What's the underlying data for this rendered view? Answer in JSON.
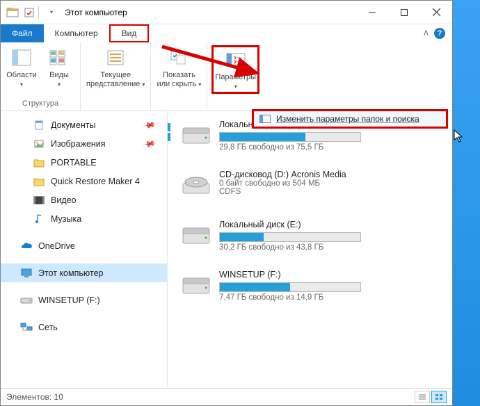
{
  "window": {
    "title": "Этот компьютер"
  },
  "tabs": {
    "file": "Файл",
    "computer": "Компьютер",
    "view": "Вид"
  },
  "ribbon": {
    "panes": {
      "label": "Области",
      "group": "Структура"
    },
    "views": {
      "label": "Виды"
    },
    "layout_group": "Структура",
    "current_view": {
      "label": "Текущее\nпредставление"
    },
    "showhide": {
      "label": "Показать\nили скрыть"
    },
    "options": {
      "label": "Параметры"
    },
    "flyout": {
      "label": "Изменить параметры папок и поиска"
    }
  },
  "nav": {
    "documents": "Документы",
    "pictures": "Изображения",
    "portable": "PORTABLE",
    "qrm": "Quick Restore Maker 4",
    "videos": "Видео",
    "music": "Музыка",
    "onedrive": "OneDrive",
    "thispc": "Этот компьютер",
    "winsetup": "WINSETUP (F:)",
    "network": "Сеть"
  },
  "drives": [
    {
      "name": "Локальный диск (C:)",
      "sub": "29,8 ГБ свободно из 75,5 ГБ",
      "fill": 61
    },
    {
      "name": "CD-дисковод (D:) Acronis Media",
      "sub": "0 байт свободно из 504 МБ",
      "sub2": "CDFS",
      "nobar": true
    },
    {
      "name": "Локальный диск (E:)",
      "sub": "30,2 ГБ свободно из 43,8 ГБ",
      "fill": 31
    },
    {
      "name": "WINSETUP (F:)",
      "sub": "7,47 ГБ свободно из 14,9 ГБ",
      "fill": 50
    }
  ],
  "status": {
    "count_label": "Элементов:",
    "count": "10"
  }
}
